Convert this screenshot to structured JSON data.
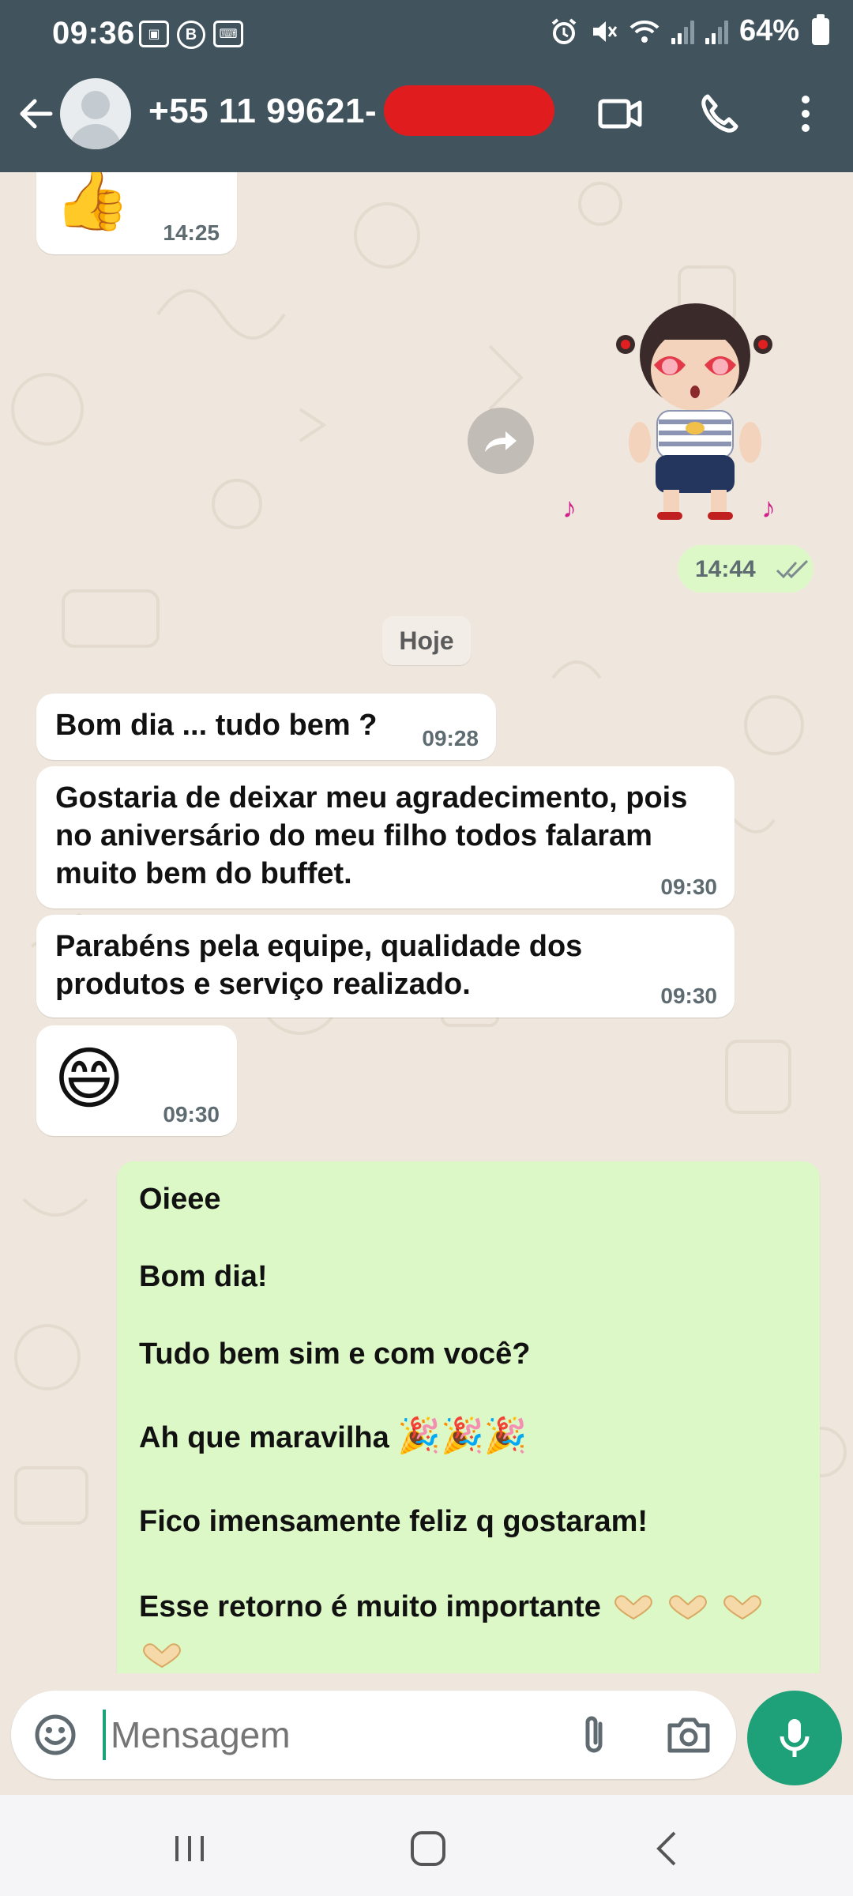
{
  "status_bar": {
    "time": "09:36",
    "battery": "64%",
    "left_icons": [
      "picture-icon",
      "b-badge-icon",
      "keyboard-icon"
    ],
    "right_icons": [
      "alarm-icon",
      "mute-icon",
      "wifi-icon",
      "signal-icon",
      "signal-icon",
      "battery-icon"
    ]
  },
  "header": {
    "contact": "+55 11 99621-",
    "icons": [
      "back-arrow-icon",
      "video-call-icon",
      "phone-icon",
      "more-vert-icon"
    ]
  },
  "messages": {
    "thumb": {
      "time": "14:25"
    },
    "sticker": {
      "time": "14:44"
    },
    "date_chip": "Hoje",
    "b1": {
      "text": "Bom dia ... tudo bem ?",
      "time": "09:28"
    },
    "b2": {
      "line1": "Gostaria de deixar meu agradecimento, pois",
      "line2": "no aniversário do meu filho todos falaram",
      "line3": "muito bem do buffet.",
      "time": "09:30"
    },
    "b3": {
      "line1": "Parabéns pela equipe, qualidade dos",
      "line2": "produtos e serviço realizado.",
      "time": "09:30"
    },
    "smile": {
      "time": "09:30"
    },
    "reply": {
      "l1": "Oieee",
      "l2": "Bom dia!",
      "l3": "Tudo bem sim e com você?",
      "l4": "Ah que maravilha",
      "l5": "Fico imensamente feliz q gostaram!",
      "l6": "Esse retorno é muito importante"
    }
  },
  "input": {
    "placeholder": "Mensagem"
  },
  "colors": {
    "header": "#41545e",
    "chat_bg": "#efe7dd",
    "outgoing": "#dcf8c6",
    "accent": "#1ea079"
  }
}
